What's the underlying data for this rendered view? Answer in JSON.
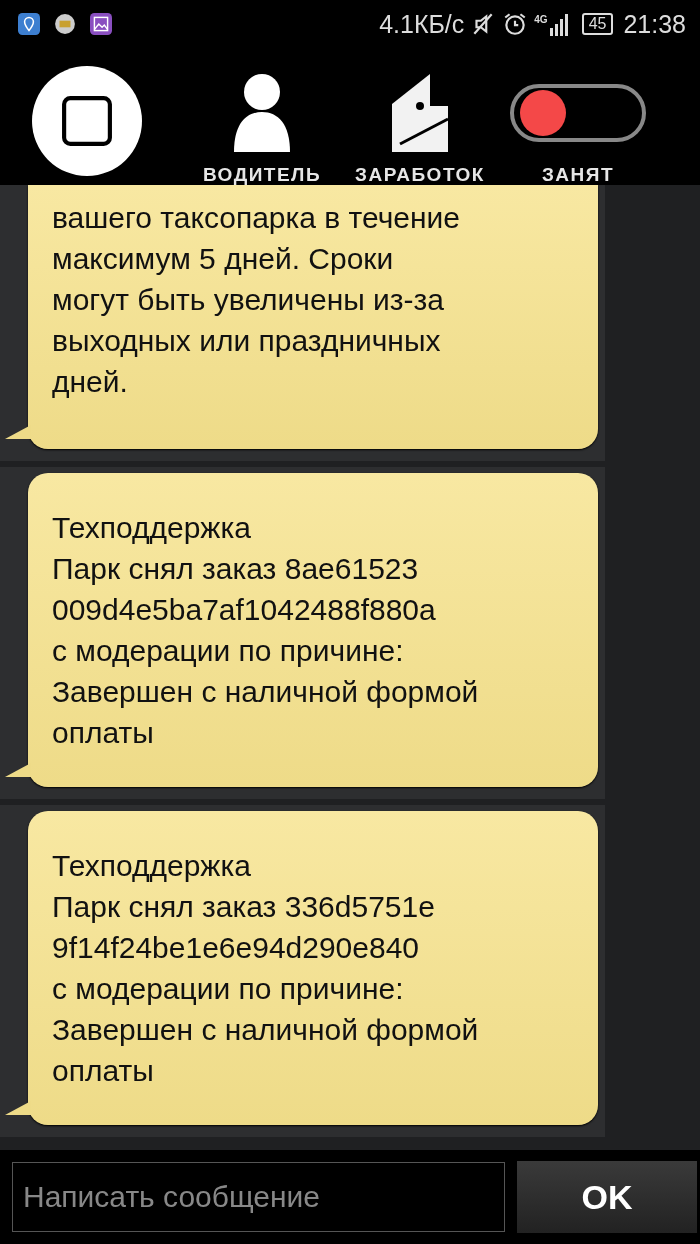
{
  "status_bar": {
    "speed": "4.1КБ/с",
    "network": "4G",
    "battery": "45",
    "time": "21:38"
  },
  "header": {
    "items": [
      {
        "kind": "avatar"
      },
      {
        "kind": "driver",
        "label": "ВОДИТЕЛЬ"
      },
      {
        "kind": "earnings",
        "label": "ЗАРАБОТОК"
      },
      {
        "kind": "toggle",
        "label": "ЗАНЯТ",
        "on": true
      }
    ]
  },
  "messages": [
    {
      "text": "вашего таксопарка в течение\nмаксимум 5 дней. Сроки\nмогут быть увеличены из-за\nвыходных или праздничных\nдней.",
      "cut_top": true
    },
    {
      "text": "Техподдержка\nПарк снял заказ 8ae61523\n009d4e5ba7af1042488f880a\nс модерации по причине:\nЗавершен с наличной формой\nоплаты",
      "cut_top": false
    },
    {
      "text": "Техподдержка\nПарк снял заказ 336d5751e\n9f14f24be1e6e94d290e840\nс модерации по причине:\nЗавершен с наличной формой\nоплаты",
      "cut_top": false
    }
  ],
  "composer": {
    "placeholder": "Написать сообщение",
    "button": "OK"
  }
}
